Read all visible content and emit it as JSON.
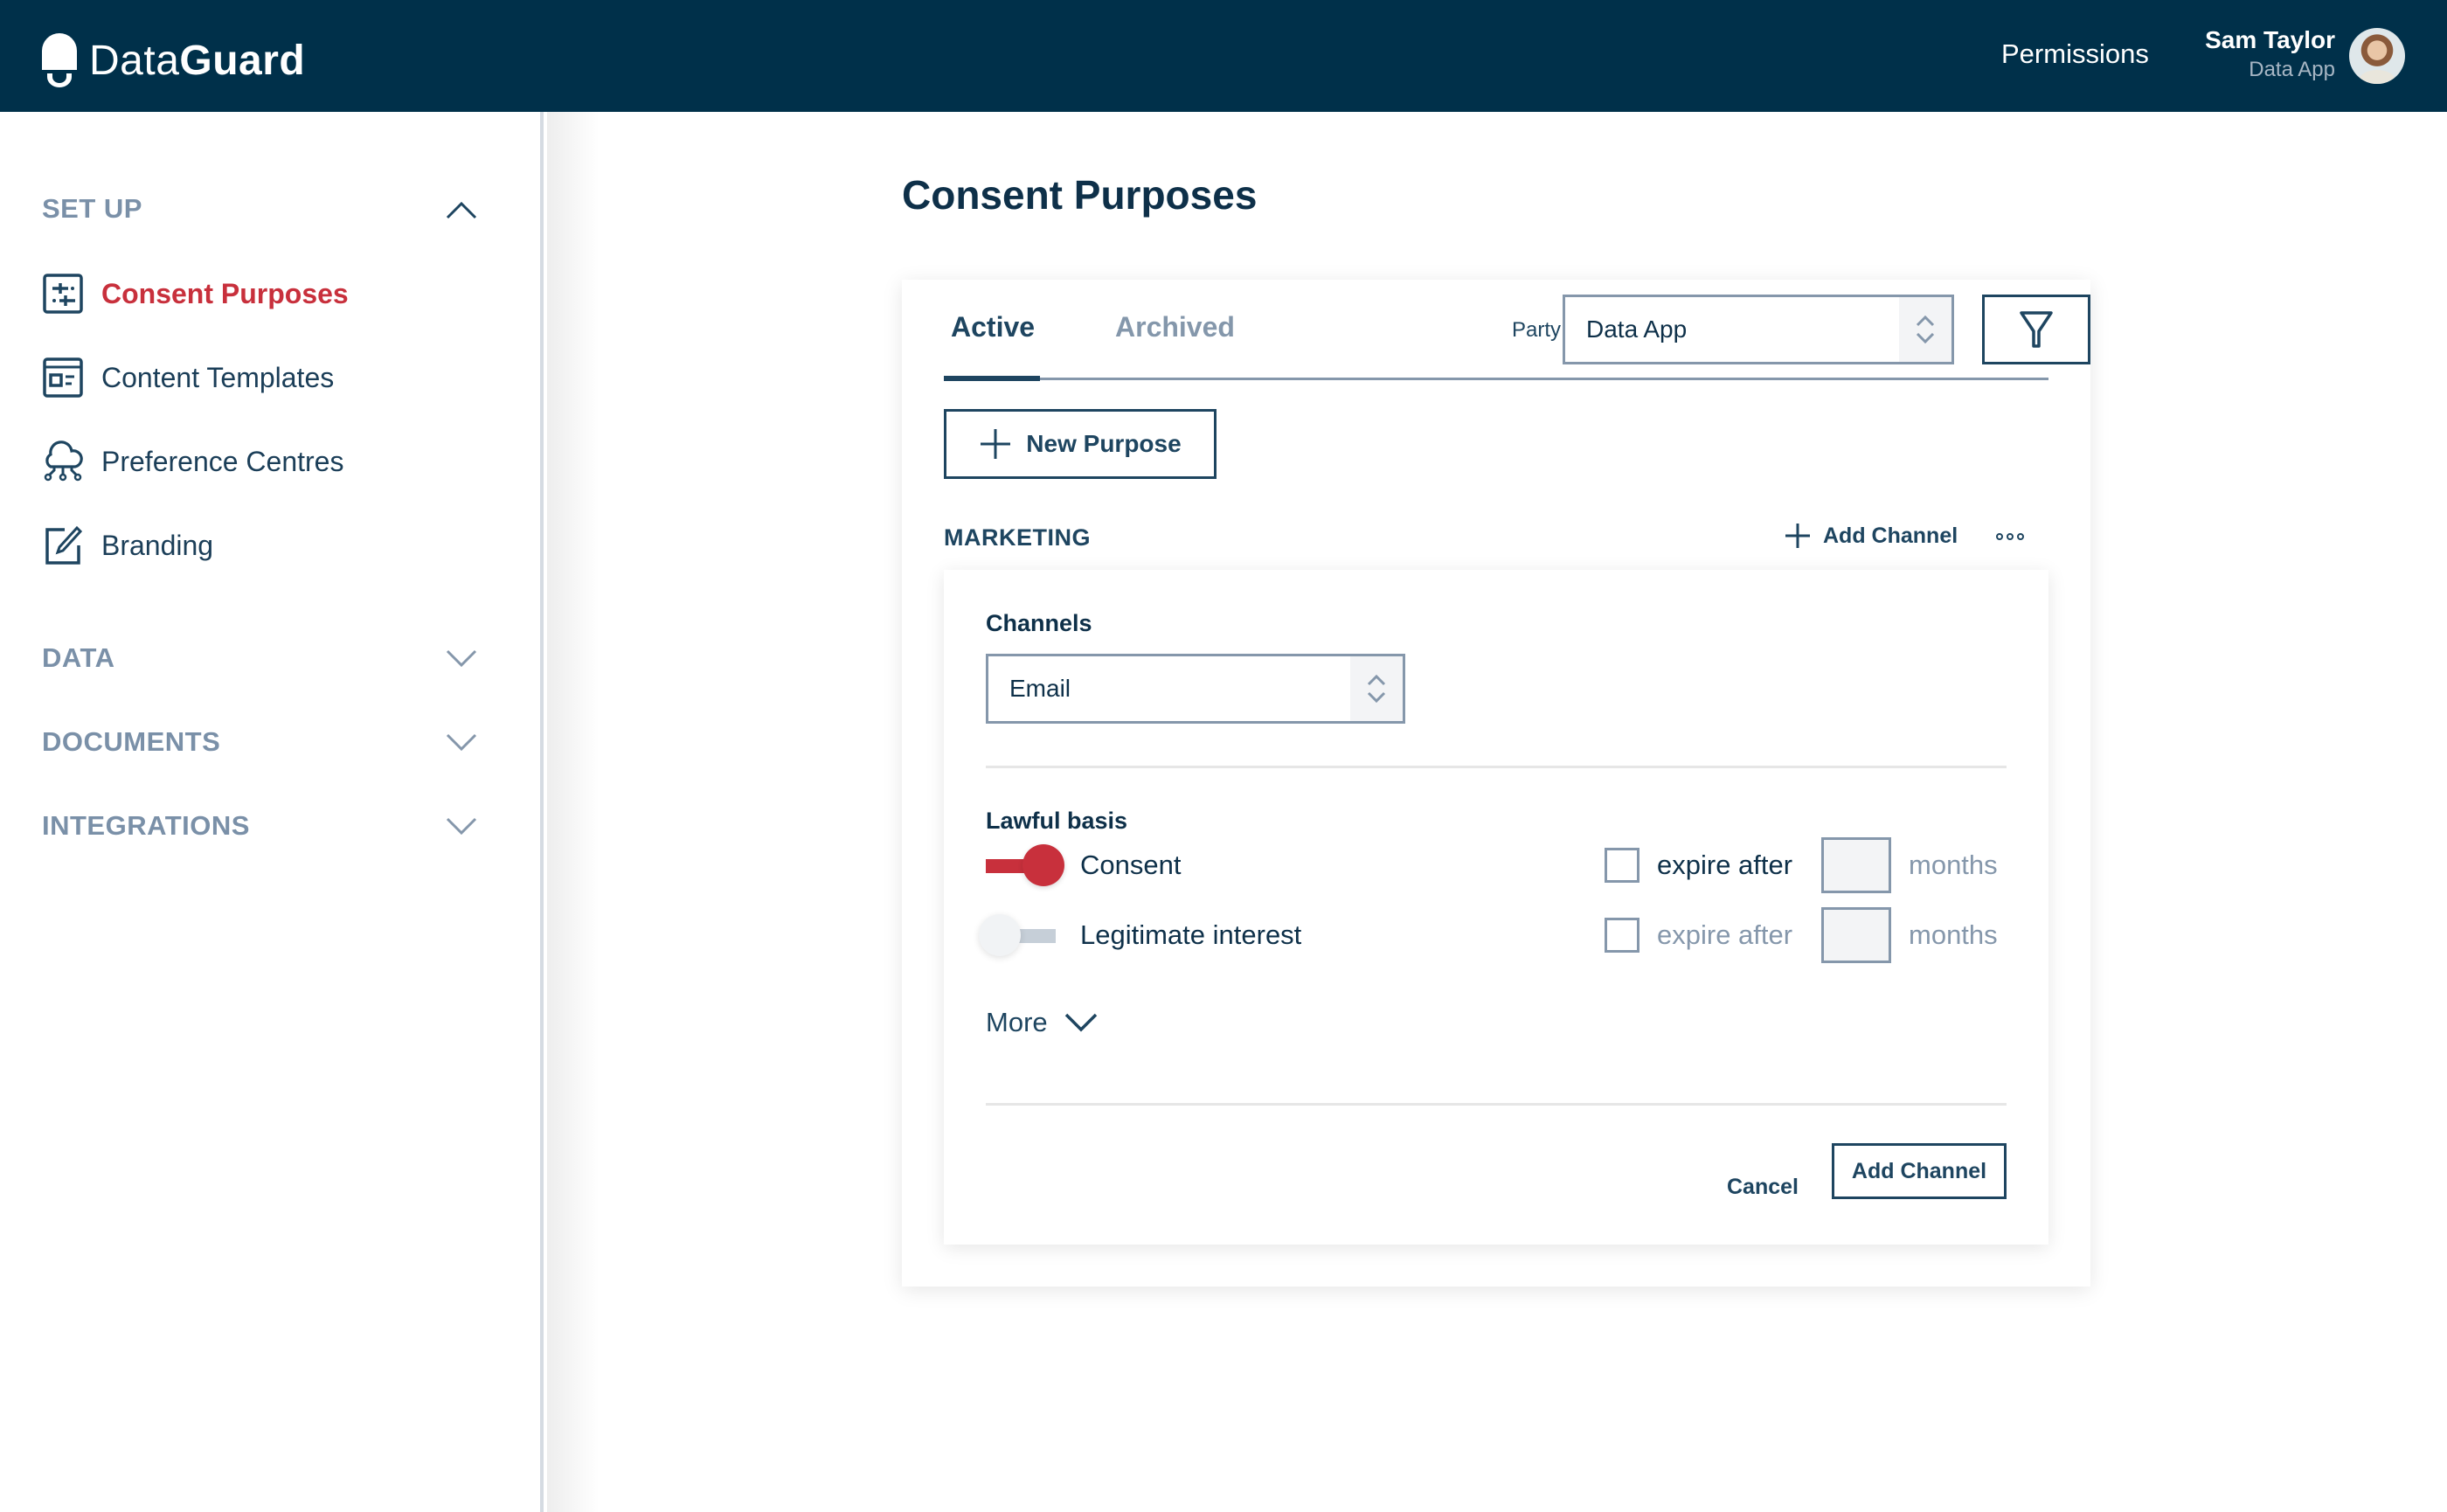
{
  "header": {
    "brand_light": "Data",
    "brand_bold": "Guard",
    "nav_permissions": "Permissions",
    "user_name": "Sam Taylor",
    "user_role": "Data App"
  },
  "sidebar": {
    "sections": [
      {
        "title": "SET UP",
        "expanded": true,
        "items": [
          {
            "label": "Consent Purposes",
            "icon": "sliders-icon",
            "active": true
          },
          {
            "label": "Content Templates",
            "icon": "template-icon",
            "active": false
          },
          {
            "label": "Preference Centres",
            "icon": "cloud-network-icon",
            "active": false
          },
          {
            "label": "Branding",
            "icon": "edit-brush-icon",
            "active": false
          }
        ]
      },
      {
        "title": "DATA",
        "expanded": false
      },
      {
        "title": "DOCUMENTS",
        "expanded": false
      },
      {
        "title": "INTEGRATIONS",
        "expanded": false
      }
    ]
  },
  "main": {
    "page_title": "Consent Purposes",
    "tabs": [
      {
        "label": "Active",
        "active": true
      },
      {
        "label": "Archived",
        "active": false
      }
    ],
    "party_label": "Party",
    "party_value": "Data App",
    "new_purpose_label": "New Purpose",
    "purpose_section": {
      "title": "MARKETING",
      "add_channel_link": "Add Channel",
      "channels_label": "Channels",
      "channel_value": "Email",
      "lawful_basis_label": "Lawful basis",
      "bases": [
        {
          "label": "Consent",
          "on": true,
          "expire_label": "expire after",
          "expire_checked": false,
          "months_value": "",
          "months_label": "months"
        },
        {
          "label": "Legitimate interest",
          "on": false,
          "expire_label": "expire after",
          "expire_checked": false,
          "months_value": "",
          "months_label": "months"
        }
      ],
      "more_label": "More",
      "cancel_label": "Cancel",
      "add_channel_button": "Add Channel"
    }
  },
  "colors": {
    "header_bg": "#00304a",
    "accent_red": "#c8303c",
    "navy_text": "#1e4560",
    "muted_text": "#8597ab"
  }
}
